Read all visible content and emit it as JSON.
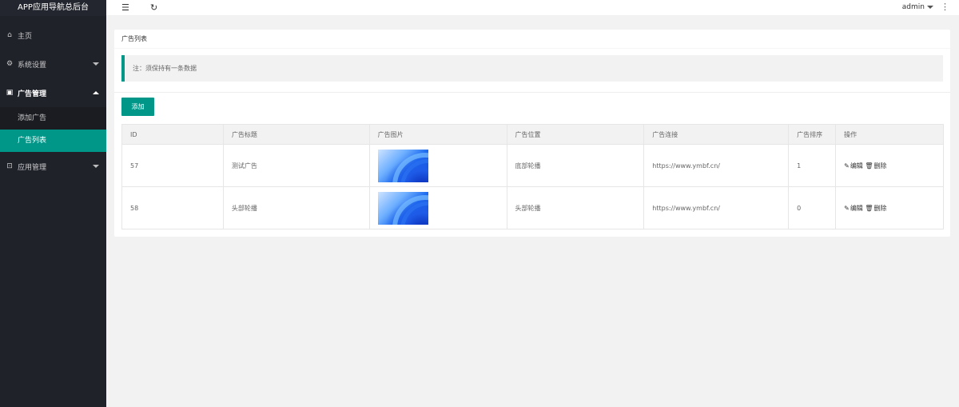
{
  "app": {
    "title": "APP应用导航总后台"
  },
  "sidebar": {
    "items": [
      {
        "icon": "home-icon",
        "label": "主页"
      },
      {
        "icon": "gear-icon",
        "label": "系统设置"
      },
      {
        "icon": "image-icon",
        "label": "广告管理",
        "expanded": true,
        "children": [
          {
            "label": "添加广告"
          },
          {
            "label": "广告列表",
            "active": true
          }
        ]
      },
      {
        "icon": "app-icon",
        "label": "应用管理"
      }
    ]
  },
  "topbar": {
    "user": "admin"
  },
  "page": {
    "title": "广告列表",
    "notice": "注：须保持有一条数据",
    "add_button": "添加"
  },
  "table": {
    "headers": [
      "ID",
      "广告标题",
      "广告图片",
      "广告位置",
      "广告连接",
      "广告排序",
      "操作"
    ],
    "rows": [
      {
        "id": "57",
        "title": "测试广告",
        "position": "底部轮播",
        "link": "https://www.ymbf.cn/",
        "sort": "1"
      },
      {
        "id": "58",
        "title": "头部轮播",
        "position": "头部轮播",
        "link": "https://www.ymbf.cn/",
        "sort": "0"
      }
    ],
    "edit_label": "编辑",
    "delete_label": "删除"
  },
  "colors": {
    "accent": "#009688",
    "sidebar": "#20222a"
  }
}
